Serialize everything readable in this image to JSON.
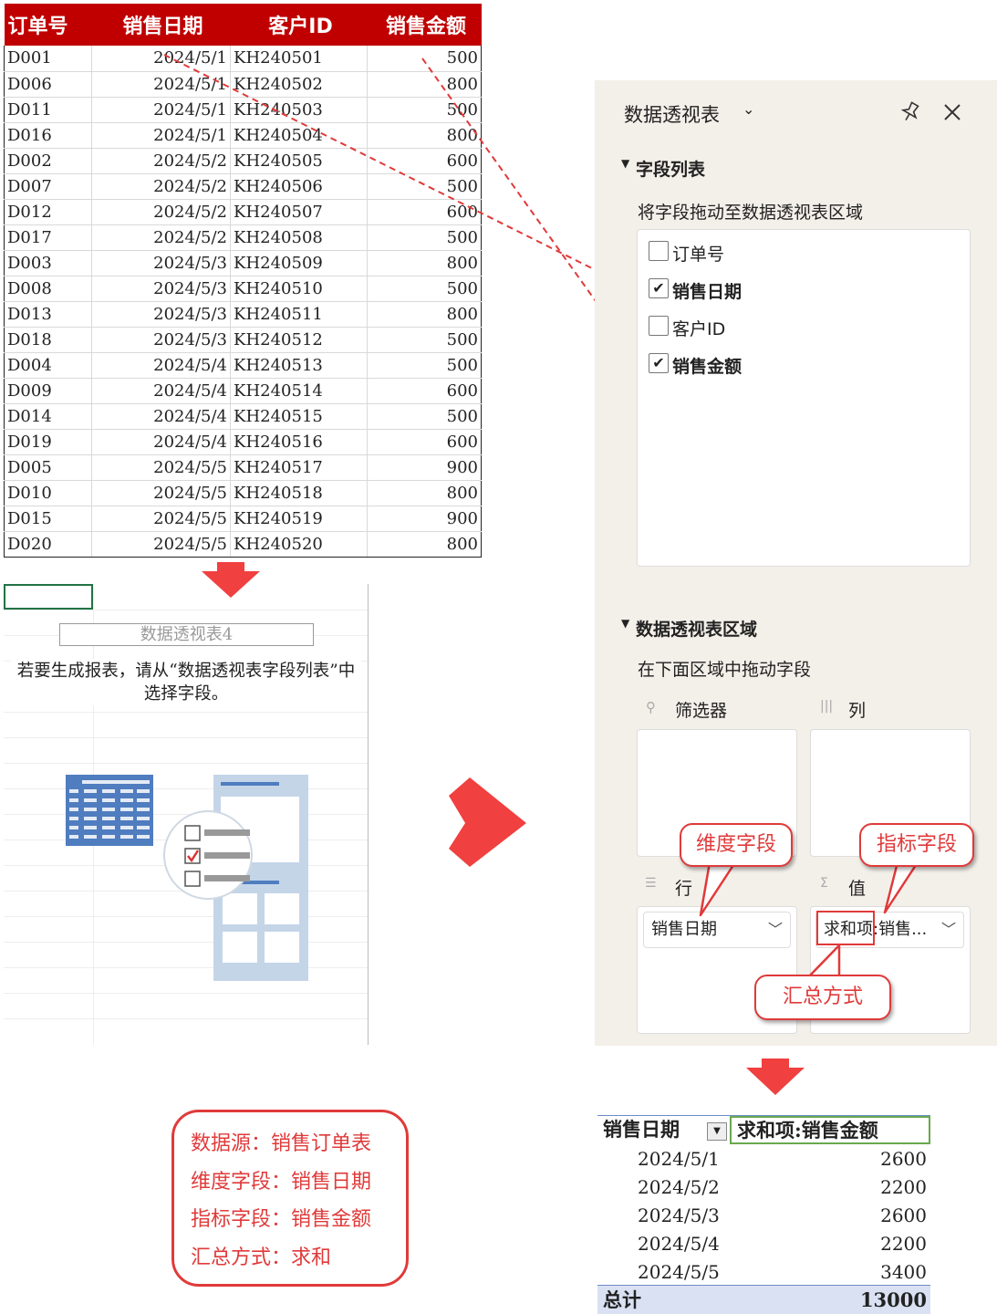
{
  "source_table": {
    "headers": [
      "订单号",
      "销售日期",
      "客户ID",
      "销售金额"
    ],
    "rows": [
      [
        "D001",
        "2024/5/1",
        "KH240501",
        "500"
      ],
      [
        "D006",
        "2024/5/1",
        "KH240502",
        "800"
      ],
      [
        "D011",
        "2024/5/1",
        "KH240503",
        "500"
      ],
      [
        "D016",
        "2024/5/1",
        "KH240504",
        "800"
      ],
      [
        "D002",
        "2024/5/2",
        "KH240505",
        "600"
      ],
      [
        "D007",
        "2024/5/2",
        "KH240506",
        "500"
      ],
      [
        "D012",
        "2024/5/2",
        "KH240507",
        "600"
      ],
      [
        "D017",
        "2024/5/2",
        "KH240508",
        "500"
      ],
      [
        "D003",
        "2024/5/3",
        "KH240509",
        "800"
      ],
      [
        "D008",
        "2024/5/3",
        "KH240510",
        "500"
      ],
      [
        "D013",
        "2024/5/3",
        "KH240511",
        "800"
      ],
      [
        "D018",
        "2024/5/3",
        "KH240512",
        "500"
      ],
      [
        "D004",
        "2024/5/4",
        "KH240513",
        "500"
      ],
      [
        "D009",
        "2024/5/4",
        "KH240514",
        "600"
      ],
      [
        "D014",
        "2024/5/4",
        "KH240515",
        "500"
      ],
      [
        "D019",
        "2024/5/4",
        "KH240516",
        "600"
      ],
      [
        "D005",
        "2024/5/5",
        "KH240517",
        "900"
      ],
      [
        "D010",
        "2024/5/5",
        "KH240518",
        "800"
      ],
      [
        "D015",
        "2024/5/5",
        "KH240519",
        "900"
      ],
      [
        "D020",
        "2024/5/5",
        "KH240520",
        "800"
      ]
    ]
  },
  "placeholder": {
    "title": "数据透视表4",
    "message": "若要生成报表，请从“数据透视表字段列表”中选择字段。"
  },
  "panel": {
    "title": "数据透视表",
    "title_chevron": "⌄",
    "pin_icon": "pin-icon",
    "close_icon": "close-icon",
    "field_section": "字段列表",
    "field_hint": "将字段拖动至数据透视表区域",
    "fields": [
      {
        "label": "订单号",
        "checked": false
      },
      {
        "label": "销售日期",
        "checked": true
      },
      {
        "label": "客户ID",
        "checked": false
      },
      {
        "label": "销售金额",
        "checked": true
      }
    ],
    "areas_section": "数据透视表区域",
    "areas_hint": "在下面区域中拖动字段",
    "filter_label": "筛选器",
    "column_label": "列",
    "row_label": "行",
    "value_label": "值",
    "row_field": "销售日期",
    "value_field": "求和项:销售..."
  },
  "callouts": {
    "dimension": "维度字段",
    "metric": "指标字段",
    "aggregation": "汇总方式"
  },
  "result": {
    "header_key": "销售日期",
    "header_value": "求和项:销售金额",
    "rows": [
      {
        "date": "2024/5/1",
        "sum": "2600"
      },
      {
        "date": "2024/5/2",
        "sum": "2200"
      },
      {
        "date": "2024/5/3",
        "sum": "2600"
      },
      {
        "date": "2024/5/4",
        "sum": "2200"
      },
      {
        "date": "2024/5/5",
        "sum": "3400"
      }
    ],
    "total_label": "总计",
    "total_value": "13000"
  },
  "summary": [
    "数据源：销售订单表",
    "维度字段：销售日期",
    "指标字段：销售金额",
    "汇总方式：求和"
  ],
  "colors": {
    "header_red": "#c00000",
    "accent_red": "#e03a3a",
    "arrow_red": "#f04040",
    "panel_bg": "#f3efe9",
    "total_bg": "#d9e1f2",
    "selection_green": "#217346"
  }
}
